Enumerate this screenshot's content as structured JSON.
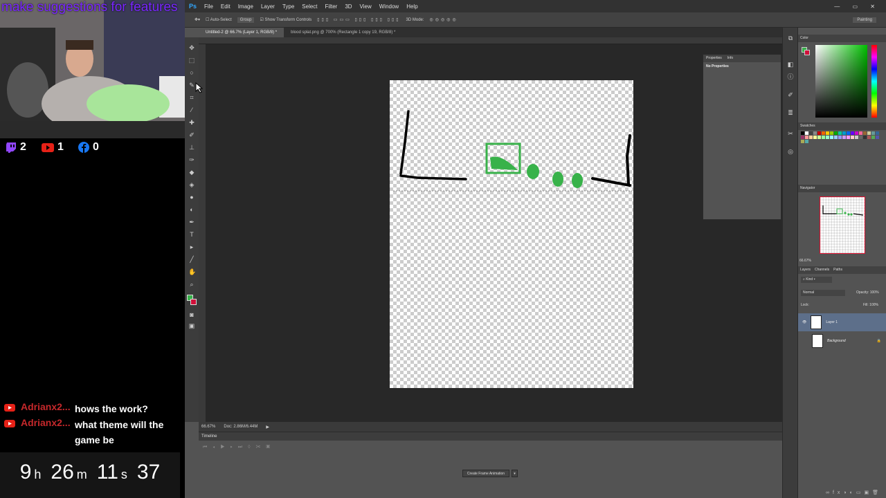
{
  "stream": {
    "banner": "make suggestions for features",
    "viewers": [
      {
        "platform": "twitch-icon",
        "count": "2",
        "color": "#9146ff"
      },
      {
        "platform": "youtube-icon",
        "count": "1",
        "color": "#e62117"
      },
      {
        "platform": "facebook-icon",
        "count": "0",
        "color": "#1877f2"
      }
    ],
    "chat": [
      {
        "name": "Adrianx2...",
        "message": "hows the work?"
      },
      {
        "name": "Adrianx2...",
        "message": "what theme will the game be"
      }
    ],
    "timer": {
      "h": "9",
      "hu": "h",
      "m": "26",
      "mu": "m",
      "s": "11",
      "su": "s",
      "ms": "37"
    }
  },
  "ps": {
    "logo": "Ps",
    "menu": [
      "File",
      "Edit",
      "Image",
      "Layer",
      "Type",
      "Select",
      "Filter",
      "3D",
      "View",
      "Window",
      "Help"
    ],
    "options": {
      "auto_select": "Auto-Select",
      "group": "Group",
      "transform": "Show Transform Controls",
      "mode3d": "3D Mode:",
      "workspace": "Painting"
    },
    "tabs": [
      "Untitled-2 @ 66.7% (Layer 1, RGB/8) *",
      "blood splat.png @ 700% (Rectangle 1 copy 19, RGB/8) *"
    ],
    "status": {
      "zoom": "66.67%",
      "doc": "Doc: 2.86M/6.44M"
    },
    "timeline": {
      "title": "Timeline",
      "create_button": "Create Frame Animation"
    },
    "properties": {
      "tab1": "Properties",
      "tab2": "Info",
      "body": "No Properties"
    },
    "panels": {
      "color": "Color",
      "swatches": "Swatches",
      "navigator": "Navigator",
      "nav_zoom": "66.67%"
    },
    "layers": {
      "tabs": [
        "Layers",
        "Channels",
        "Paths"
      ],
      "kind": "Kind",
      "blend": "Normal",
      "opacity_label": "Opacity:",
      "opacity": "100%",
      "lock_label": "Lock:",
      "fill_label": "Fill:",
      "fill": "100%",
      "items": [
        {
          "name": "Layer 1",
          "selected": true
        },
        {
          "name": "Background",
          "selected": false
        }
      ]
    },
    "colors": {
      "foreground": "#38b24a",
      "background": "#d0103a"
    }
  }
}
